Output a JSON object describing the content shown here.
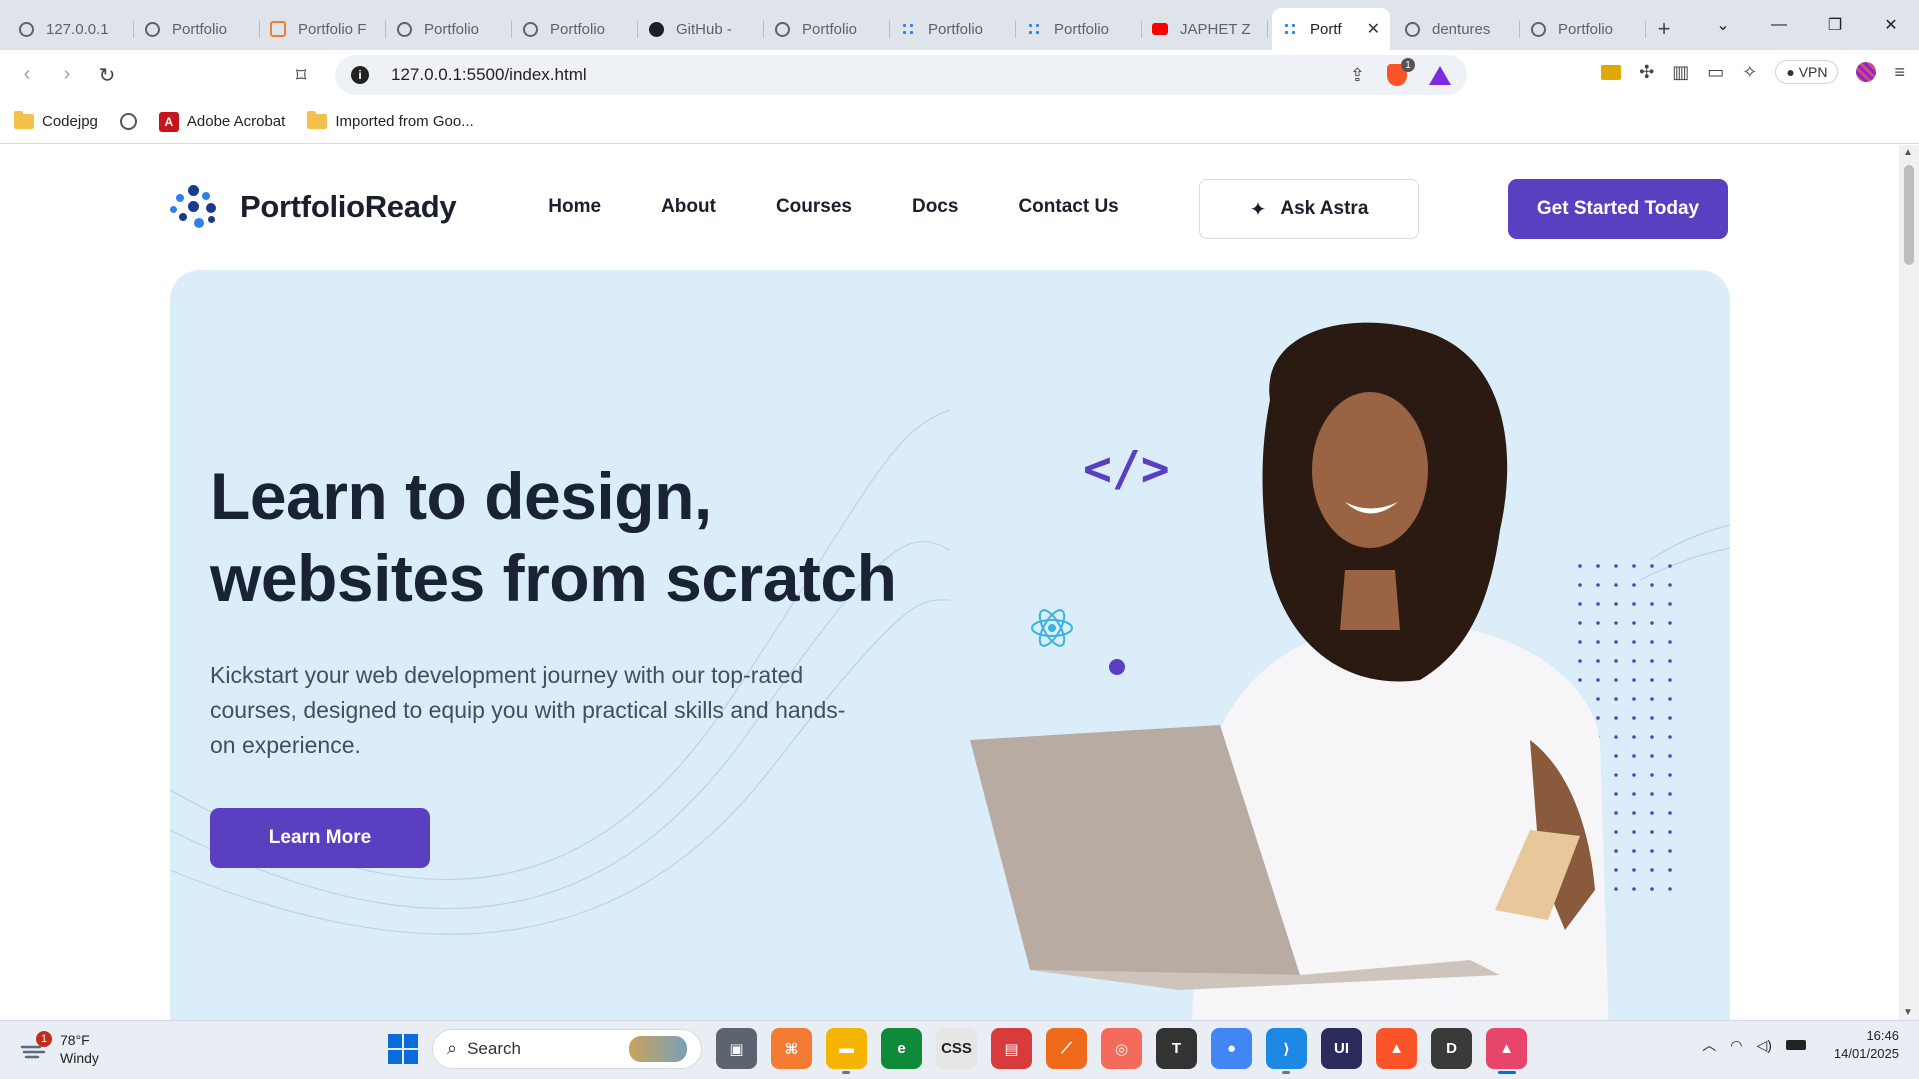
{
  "browser": {
    "tabs": [
      {
        "label": "127.0.0.1",
        "favicon": "globe"
      },
      {
        "label": "Portfolio",
        "favicon": "globe"
      },
      {
        "label": "Portfolio F",
        "favicon": "xampp"
      },
      {
        "label": "Portfolio",
        "favicon": "globe"
      },
      {
        "label": "Portfolio",
        "favicon": "globe"
      },
      {
        "label": "GitHub -",
        "favicon": "github"
      },
      {
        "label": "Portfolio",
        "favicon": "globe"
      },
      {
        "label": "Portfolio",
        "favicon": "portfolioready"
      },
      {
        "label": "Portfolio",
        "favicon": "portfolioready"
      },
      {
        "label": "JAPHET Z",
        "favicon": "youtube"
      },
      {
        "label": "Portf",
        "favicon": "portfolioready",
        "active": true
      },
      {
        "label": "dentures",
        "favicon": "globe"
      },
      {
        "label": "Portfolio",
        "favicon": "globe"
      }
    ],
    "new_tab": "+",
    "url": "127.0.0.1:5500/index.html",
    "vpn_label": "VPN",
    "brave_badge": "1",
    "bookmarks": [
      {
        "label": "Codejpg",
        "icon": "folder-icon"
      },
      {
        "label": "",
        "icon": "globe-icon"
      },
      {
        "label": "Adobe Acrobat",
        "icon": "acrobat-icon"
      },
      {
        "label": "Imported from Goo...",
        "icon": "folder-icon"
      }
    ]
  },
  "site": {
    "brand": "PortfolioReady",
    "nav": [
      "Home",
      "About",
      "Courses",
      "Docs",
      "Contact Us"
    ],
    "ask_label": "Ask Astra",
    "cta_label": "Get Started Today",
    "hero": {
      "title_line1": "Learn to design,",
      "title_line2": "websites from scratch",
      "subtitle": "Kickstart your web development journey with our top-rated courses, designed to equip you with practical skills and hands-on experience.",
      "button": "Learn More",
      "code_glyph": "</>"
    },
    "colors": {
      "primary": "#5a3fc0",
      "hero_bg": "#dbedf9",
      "heading": "#1a2235"
    }
  },
  "taskbar": {
    "weather_temp": "78°F",
    "weather_desc": "Windy",
    "weather_badge": "1",
    "search_placeholder": "Search",
    "time": "16:46",
    "date": "14/01/2025",
    "apps": [
      {
        "name": "task-view",
        "color": "#5c6470",
        "glyph": "▣"
      },
      {
        "name": "xampp",
        "color": "#f47c32",
        "glyph": "⌘"
      },
      {
        "name": "file-explorer",
        "color": "#f4b400",
        "glyph": "▬"
      },
      {
        "name": "edge-green",
        "color": "#0f8a3a",
        "glyph": "e"
      },
      {
        "name": "css",
        "color": "#e6e6e6",
        "glyph": "CSS"
      },
      {
        "name": "store",
        "color": "#d83b3b",
        "glyph": "▤"
      },
      {
        "name": "orange-app",
        "color": "#f06a1c",
        "glyph": "⟋"
      },
      {
        "name": "ring-app",
        "color": "#f56a5a",
        "glyph": "◎"
      },
      {
        "name": "typora",
        "color": "#333",
        "glyph": "T"
      },
      {
        "name": "chrome",
        "color": "#4285f4",
        "glyph": "●"
      },
      {
        "name": "vscode",
        "color": "#1e88e5",
        "glyph": "⟩"
      },
      {
        "name": "uizard",
        "color": "#2b2b5e",
        "glyph": "UI"
      },
      {
        "name": "brave",
        "color": "#fb542b",
        "glyph": "▲"
      },
      {
        "name": "dreamweaver",
        "color": "#3a3a3a",
        "glyph": "D"
      },
      {
        "name": "brave-nightly",
        "color": "#e8456b",
        "glyph": "▲"
      }
    ]
  }
}
